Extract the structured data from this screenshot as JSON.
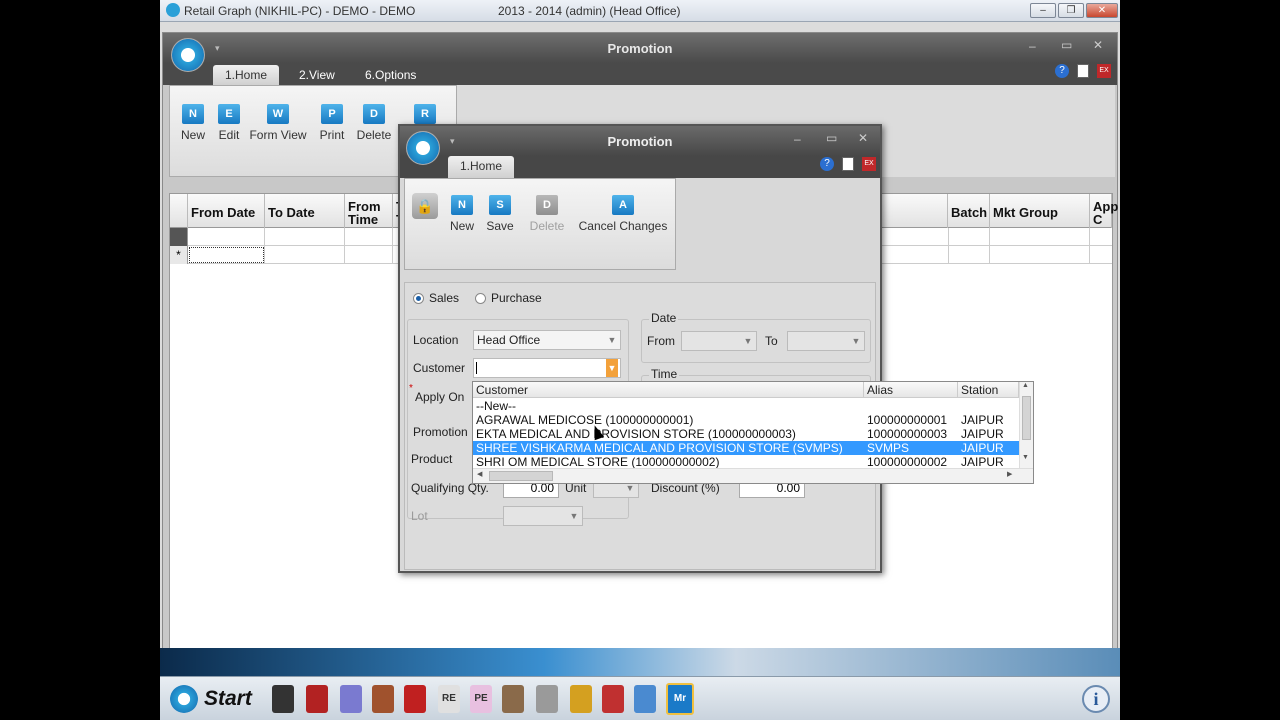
{
  "outer_window": {
    "title_left": "Retail Graph (NIKHIL-PC) - DEMO - DEMO",
    "title_center": "2013 - 2014 (admin) (Head Office)"
  },
  "background_window": {
    "title": "Promotion",
    "tabs": [
      "1.Home",
      "2.View",
      "6.Options"
    ],
    "ribbon_buttons": [
      {
        "label": "New",
        "icon_letter": "N"
      },
      {
        "label": "Edit",
        "icon_letter": "E"
      },
      {
        "label": "Form View",
        "icon_letter": "W"
      },
      {
        "label": "Print",
        "icon_letter": "P"
      },
      {
        "label": "Delete",
        "icon_letter": "D"
      },
      {
        "label": "",
        "icon_letter": "R"
      }
    ],
    "grid_columns": [
      "From Date",
      "To Date",
      "From Time",
      "T T",
      "Batch",
      "Mkt Group",
      "App C"
    ],
    "new_row_marker": "*"
  },
  "dialog": {
    "title": "Promotion",
    "tab": "1.Home",
    "ribbon_buttons": [
      {
        "label": "New",
        "icon_letter": "N",
        "enabled": true
      },
      {
        "label": "Save",
        "icon_letter": "S",
        "enabled": true
      },
      {
        "label": "Delete",
        "icon_letter": "D",
        "enabled": false
      },
      {
        "label": "Cancel Changes",
        "icon_letter": "A",
        "enabled": true
      }
    ],
    "radio_sales": "Sales",
    "radio_purchase": "Purchase",
    "location_label": "Location",
    "location_value": "Head Office",
    "customer_label": "Customer",
    "customer_value": "",
    "apply_on_label": "Apply On",
    "required_mark": "*",
    "promotion_label": "Promotion",
    "product_label": "Product",
    "qualifying_qty_label": "Qualifying Qty.",
    "qualifying_qty_value": "0.00",
    "unit_label": "Unit",
    "discount_label": "Discount (%)",
    "discount_value": "0.00",
    "lot_label": "Lot",
    "date_group": "Date",
    "from_label": "From",
    "to_label": "To",
    "time_group": "Time"
  },
  "customer_dropdown": {
    "columns": [
      "Customer",
      "Alias",
      "Station"
    ],
    "rows": [
      {
        "customer": "--New--",
        "alias": "",
        "station": ""
      },
      {
        "customer": "AGRAWAL MEDICOSE (100000000001)",
        "alias": "100000000001",
        "station": "JAIPUR"
      },
      {
        "customer": "EKTA MEDICAL AND PROVISION STORE (100000000003)",
        "alias": "100000000003",
        "station": "JAIPUR"
      },
      {
        "customer": "SHREE VISHKARMA MEDICAL AND PROVISION STORE (SVMPS)",
        "alias": "SVMPS",
        "station": "JAIPUR",
        "selected": true
      },
      {
        "customer": "SHRI OM MEDICAL STORE (100000000002)",
        "alias": "100000000002",
        "station": "JAIPUR"
      }
    ]
  },
  "taskbar": {
    "start_label": "Start"
  },
  "colors": {
    "accent_blue": "#1779c2",
    "selection": "#3399ff",
    "title_dark": "#4a4a4a"
  }
}
